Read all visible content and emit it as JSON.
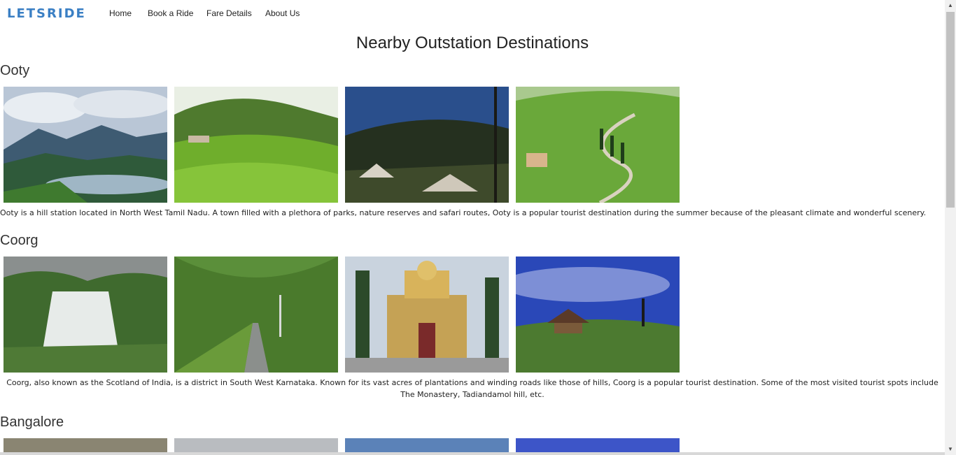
{
  "nav": {
    "brand": "LETSRIDE",
    "links": [
      "Home",
      "Book a Ride",
      "Fare Details",
      "About Us"
    ]
  },
  "page_title": "Nearby Outstation Destinations",
  "sections": [
    {
      "title": "Ooty",
      "description": "Ooty is a hill station located in North West Tamil Nadu. A town filled with a plethora of parks, nature reserves and safari routes, Ooty is a popular tourist destination during the summer because of the pleasant climate and wonderful scenery.",
      "photos": [
        "ooty-lake-mountains-photo",
        "ooty-tea-garden-photo",
        "ooty-campsite-photo",
        "ooty-winding-road-photo"
      ]
    },
    {
      "title": "Coorg",
      "description": "Coorg, also known as the Scotland of India, is a district in South West Karnataka. Known for its vast acres of plantations and winding roads like those of hills, Coorg is a popular tourist destination. Some of the most visited tourist spots include The Monastery, Tadiandamol hill, etc.",
      "photos": [
        "coorg-waterfall-photo",
        "coorg-bamboo-road-photo",
        "coorg-monastery-photo",
        "coorg-hilltop-cottage-photo"
      ]
    },
    {
      "title": "Bangalore",
      "photos": [
        "bangalore-skyline-photo",
        "bangalore-tower-photo",
        "bangalore-sky-photo",
        "bangalore-night-photo"
      ]
    }
  ],
  "scrollbar": {
    "up_icon": "▲",
    "down_icon": "▼"
  }
}
